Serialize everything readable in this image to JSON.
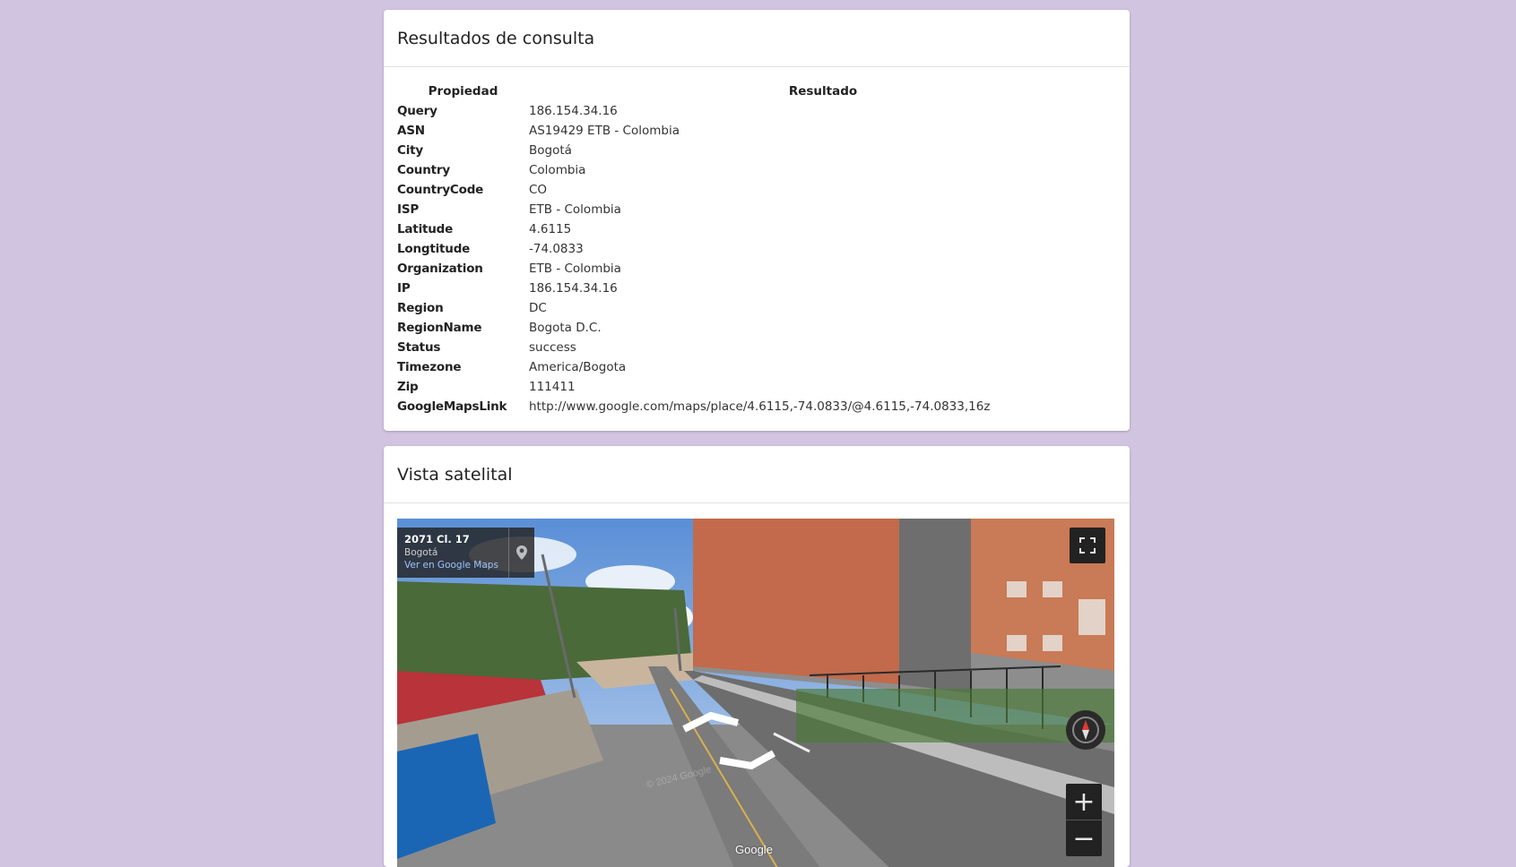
{
  "results": {
    "title": "Resultados de consulta",
    "headers": [
      "Propiedad",
      "Resultado"
    ],
    "rows": [
      {
        "prop": "Query",
        "val": "186.154.34.16"
      },
      {
        "prop": "ASN",
        "val": "AS19429 ETB - Colombia"
      },
      {
        "prop": "City",
        "val": "Bogotá"
      },
      {
        "prop": "Country",
        "val": "Colombia"
      },
      {
        "prop": "CountryCode",
        "val": "CO"
      },
      {
        "prop": "ISP",
        "val": "ETB - Colombia"
      },
      {
        "prop": "Latitude",
        "val": "4.6115"
      },
      {
        "prop": "Longtitude",
        "val": "-74.0833"
      },
      {
        "prop": "Organization",
        "val": "ETB - Colombia"
      },
      {
        "prop": "IP",
        "val": "186.154.34.16"
      },
      {
        "prop": "Region",
        "val": "DC"
      },
      {
        "prop": "RegionName",
        "val": "Bogota D.C."
      },
      {
        "prop": "Status",
        "val": "success"
      },
      {
        "prop": "Timezone",
        "val": "America/Bogota"
      },
      {
        "prop": "Zip",
        "val": "111411"
      },
      {
        "prop": "GoogleMapsLink",
        "val": "http://www.google.com/maps/place/4.6115,-74.0833/@4.6115,-74.0833,16z"
      }
    ]
  },
  "satellite": {
    "title": "Vista satelital",
    "address": "2071 Cl. 17",
    "city": "Bogotá",
    "maps_link": "Ver en Google Maps",
    "zoom_in": "+",
    "zoom_out": "−",
    "logo": "Google",
    "watermark": "© 2024 Google",
    "icons": [
      "pin-icon",
      "fullscreen-icon",
      "compass-icon"
    ]
  }
}
